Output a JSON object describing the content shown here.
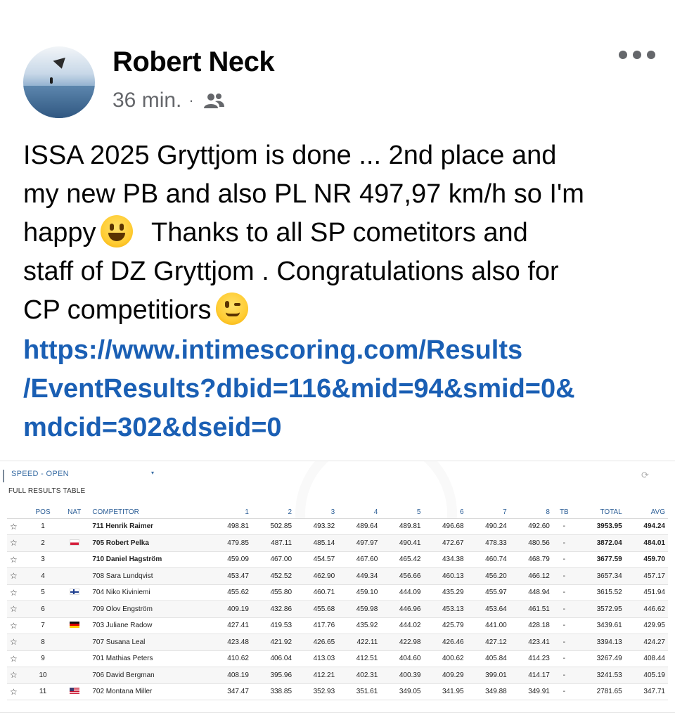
{
  "post": {
    "author": "Robert Neck",
    "time": "36 min.",
    "separator": "·",
    "audience_icon": "friends-icon",
    "more_icon": "more-options-icon",
    "text_line1": "ISSA 2025 Gryttjom is done ... 2nd place and",
    "text_line2": "my new PB and also PL NR 497,97 km/h so I'm",
    "text_line3a": "happy",
    "text_line3b": "  Thanks to all SP cometitors and",
    "text_line4": "staff of DZ Gryttjom . Congratulations also for",
    "text_line5": "CP competitiors",
    "link_line1": "https://www.intimescoring.com/Results",
    "link_line2": "/EventResults?dbid=116&mid=94&smid=0&",
    "link_line3": "mdcid=302&dseid=0",
    "link_color": "#1a5fb4"
  },
  "results": {
    "category": "SPEED - OPEN",
    "subtitle": "FULL RESULTS TABLE",
    "headers": [
      "POS",
      "NAT",
      "COMPETITOR",
      "1",
      "2",
      "3",
      "4",
      "5",
      "6",
      "7",
      "8",
      "TB",
      "TOTAL",
      "AVG"
    ],
    "rows": [
      {
        "pos": "1",
        "flag": "",
        "competitor": "711 Henrik Raimer",
        "r1": "498.81",
        "r2": "502.85",
        "r3": "493.32",
        "r4": "489.64",
        "r5": "489.81",
        "r6": "496.68",
        "r7": "490.24",
        "r8": "492.60",
        "tb": "-",
        "total": "3953.95",
        "avg": "494.24"
      },
      {
        "pos": "2",
        "flag": "pl",
        "competitor": "705 Robert Pelka",
        "r1": "479.85",
        "r2": "487.11",
        "r3": "485.14",
        "r4": "497.97",
        "r5": "490.41",
        "r6": "472.67",
        "r7": "478.33",
        "r8": "480.56",
        "tb": "-",
        "total": "3872.04",
        "avg": "484.01"
      },
      {
        "pos": "3",
        "flag": "",
        "competitor": "710 Daniel Hagström",
        "r1": "459.09",
        "r2": "467.00",
        "r3": "454.57",
        "r4": "467.60",
        "r5": "465.42",
        "r6": "434.38",
        "r7": "460.74",
        "r8": "468.79",
        "tb": "-",
        "total": "3677.59",
        "avg": "459.70"
      },
      {
        "pos": "4",
        "flag": "",
        "competitor": "708 Sara Lundqvist",
        "r1": "453.47",
        "r2": "452.52",
        "r3": "462.90",
        "r4": "449.34",
        "r5": "456.66",
        "r6": "460.13",
        "r7": "456.20",
        "r8": "466.12",
        "tb": "-",
        "total": "3657.34",
        "avg": "457.17"
      },
      {
        "pos": "5",
        "flag": "fi",
        "competitor": "704 Niko Kiviniemi",
        "r1": "455.62",
        "r2": "455.80",
        "r3": "460.71",
        "r4": "459.10",
        "r5": "444.09",
        "r6": "435.29",
        "r7": "455.97",
        "r8": "448.94",
        "tb": "-",
        "total": "3615.52",
        "avg": "451.94"
      },
      {
        "pos": "6",
        "flag": "",
        "competitor": "709 Olov Engström",
        "r1": "409.19",
        "r2": "432.86",
        "r3": "455.68",
        "r4": "459.98",
        "r5": "446.96",
        "r6": "453.13",
        "r7": "453.64",
        "r8": "461.51",
        "tb": "-",
        "total": "3572.95",
        "avg": "446.62"
      },
      {
        "pos": "7",
        "flag": "de",
        "competitor": "703 Juliane Radow",
        "r1": "427.41",
        "r2": "419.53",
        "r3": "417.76",
        "r4": "435.92",
        "r5": "444.02",
        "r6": "425.79",
        "r7": "441.00",
        "r8": "428.18",
        "tb": "-",
        "total": "3439.61",
        "avg": "429.95"
      },
      {
        "pos": "8",
        "flag": "",
        "competitor": "707 Susana Leal",
        "r1": "423.48",
        "r2": "421.92",
        "r3": "426.65",
        "r4": "422.11",
        "r5": "422.98",
        "r6": "426.46",
        "r7": "427.12",
        "r8": "423.41",
        "tb": "-",
        "total": "3394.13",
        "avg": "424.27"
      },
      {
        "pos": "9",
        "flag": "",
        "competitor": "701 Mathias Peters",
        "r1": "410.62",
        "r2": "406.04",
        "r3": "413.03",
        "r4": "412.51",
        "r5": "404.60",
        "r6": "400.62",
        "r7": "405.84",
        "r8": "414.23",
        "tb": "-",
        "total": "3267.49",
        "avg": "408.44"
      },
      {
        "pos": "10",
        "flag": "",
        "competitor": "706 David Bergman",
        "r1": "408.19",
        "r2": "395.96",
        "r3": "412.21",
        "r4": "402.31",
        "r5": "400.39",
        "r6": "409.29",
        "r7": "399.01",
        "r8": "414.17",
        "tb": "-",
        "total": "3241.53",
        "avg": "405.19"
      },
      {
        "pos": "11",
        "flag": "us",
        "competitor": "702 Montana Miller",
        "r1": "347.47",
        "r2": "338.85",
        "r3": "352.93",
        "r4": "351.61",
        "r5": "349.05",
        "r6": "341.95",
        "r7": "349.88",
        "r8": "349.91",
        "tb": "-",
        "total": "2781.65",
        "avg": "347.71"
      }
    ]
  }
}
